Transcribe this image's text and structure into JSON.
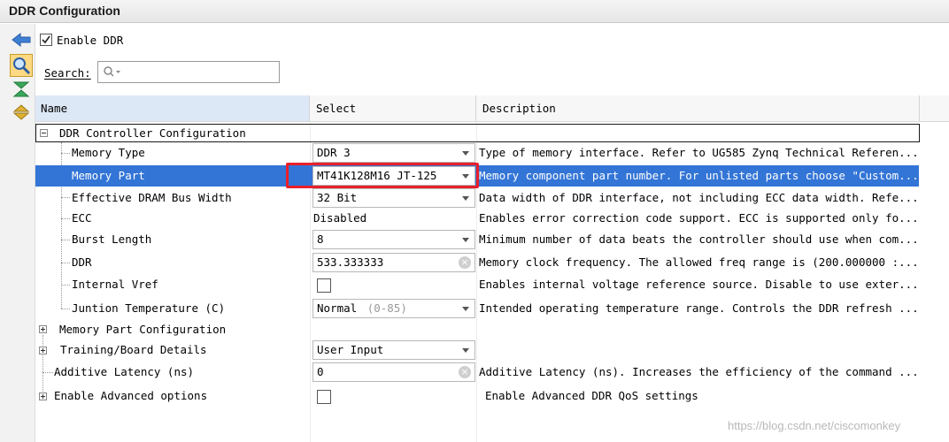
{
  "window": {
    "title": "DDR Configuration"
  },
  "toolbar": {
    "enable_ddr_label": "Enable DDR",
    "enable_ddr_checked": true
  },
  "search": {
    "label": "Search:",
    "placeholder": ""
  },
  "table": {
    "columns": [
      "Name",
      "Select",
      "Description"
    ],
    "group": {
      "label": "DDR Controller Configuration"
    },
    "rows": [
      {
        "name": "Memory Type",
        "value": "DDR 3",
        "description": "Type of memory interface. Refer to UG585 Zynq Technical Referen..."
      },
      {
        "name": "Memory Part",
        "value": "MT41K128M16 JT-125",
        "description": "Memory component part number. For unlisted parts choose \"Custom...",
        "selected": true
      },
      {
        "name": "Effective DRAM Bus Width",
        "value": "32 Bit",
        "description": "Data width of DDR interface, not including ECC data width. Refe..."
      },
      {
        "name": "ECC",
        "value": "Disabled",
        "description": "Enables error correction code support. ECC is supported only fo..."
      },
      {
        "name": "Burst Length",
        "value": "8",
        "description": "Minimum number of data beats the controller should use when com..."
      },
      {
        "name": "DDR",
        "value": "533.333333",
        "description": "Memory clock frequency. The allowed freq range is (200.000000 :..."
      },
      {
        "name": "Internal Vref",
        "value": "",
        "description": "Enables internal voltage reference source. Disable to use exter..."
      },
      {
        "name": "Juntion Temperature (C)",
        "value": "Normal",
        "value_hint": "(0-85)",
        "description": "Intended operating temperature range. Controls the DDR refresh ..."
      },
      {
        "name": "Memory Part Configuration",
        "value": "",
        "description": ""
      },
      {
        "name": "Training/Board Details",
        "value": "User Input",
        "description": ""
      },
      {
        "name": "Additive Latency (ns)",
        "value": "0",
        "description": "Additive Latency (ns). Increases the efficiency of the command ..."
      },
      {
        "name": "Enable Advanced options",
        "value": "",
        "description": "Enable Advanced DDR QoS settings"
      }
    ]
  },
  "watermark": "https://blog.csdn.net/ciscomonkey",
  "colors": {
    "selection": "#3375d6",
    "highlight": "#e8202a"
  }
}
